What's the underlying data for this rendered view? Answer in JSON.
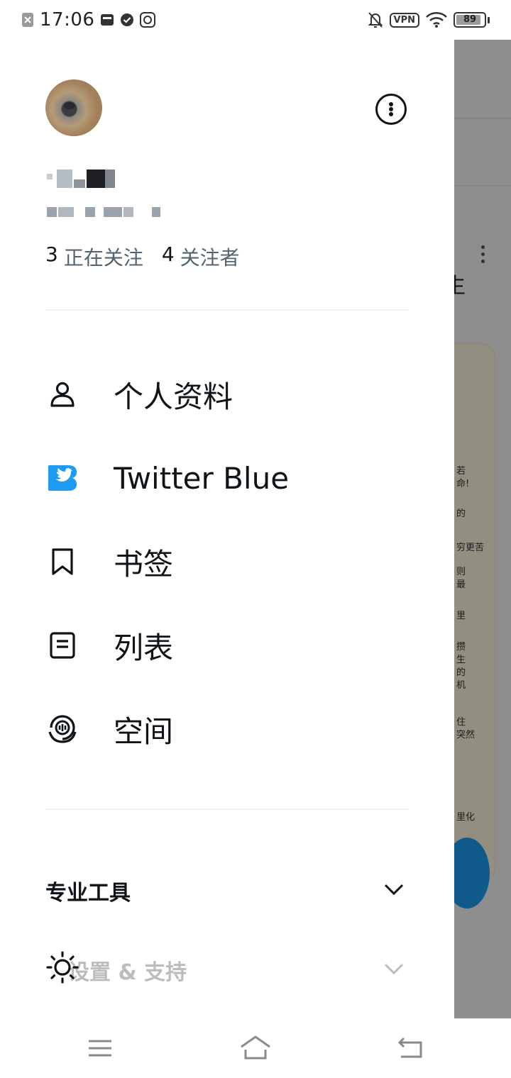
{
  "status_bar": {
    "time": "17:06",
    "vpn_label": "VPN",
    "battery_level": "89",
    "battery_fraction": 0.89
  },
  "drawer": {
    "follow": {
      "following_count": "3",
      "following_label": "正在关注",
      "followers_count": "4",
      "followers_label": "关注者"
    },
    "menu": [
      {
        "label": "个人资料",
        "icon": "profile-icon"
      },
      {
        "label": "Twitter Blue",
        "icon": "twitter-blue-icon"
      },
      {
        "label": "书签",
        "icon": "bookmark-icon"
      },
      {
        "label": "列表",
        "icon": "list-icon"
      },
      {
        "label": "空间",
        "icon": "spaces-icon"
      }
    ],
    "sections": {
      "pro_tools": "专业工具",
      "settings_support": "设置 & 支持"
    }
  },
  "background_app": {
    "headline_fragment": "生",
    "card_lines": [
      "若",
      "命!",
      "的",
      "穷更苦",
      "则",
      "最",
      "里",
      "攒",
      "生",
      "的",
      "机",
      "住",
      "突然",
      "里化"
    ]
  },
  "colors": {
    "accent": "#1d9bf0",
    "text_primary": "#0f1419",
    "text_secondary": "#536471",
    "divider": "#eff3f4"
  }
}
